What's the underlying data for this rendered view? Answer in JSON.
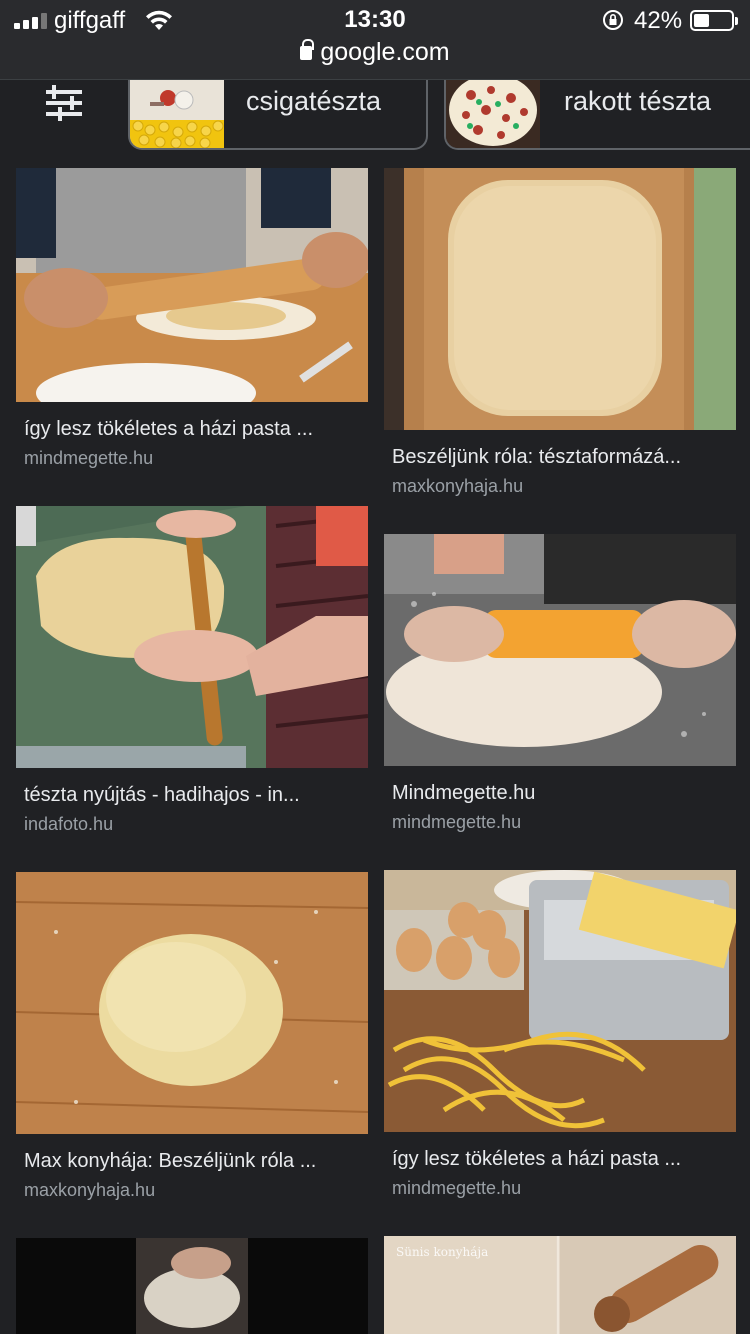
{
  "status_bar": {
    "carrier": "giffgaff",
    "time": "13:30",
    "battery_percent": "42%",
    "battery_level": 0.42
  },
  "address_bar": {
    "url": "google.com"
  },
  "chips": [
    {
      "label": "csigatészta",
      "icon": "pasta-thumb"
    },
    {
      "label": "rakott tészta",
      "icon": "baked-pasta-thumb"
    }
  ],
  "results": [
    {
      "title": "így lesz tökéletes a házi pasta ...",
      "source": "mindmegette.hu"
    },
    {
      "title": "Beszéljünk róla: tésztaformázá...",
      "source": "maxkonyhaja.hu"
    },
    {
      "title": "tészta nyújtás - hadihajos - in...",
      "source": "indafoto.hu"
    },
    {
      "title": "Mindmegette.hu",
      "source": "mindmegette.hu"
    },
    {
      "title": "Max konyhája: Beszéljünk róla ...",
      "source": "maxkonyhaja.hu"
    },
    {
      "title": "így lesz tökéletes a házi pasta ...",
      "source": "mindmegette.hu"
    }
  ],
  "partial_images": [
    {
      "watermark": "Sünis konyhája"
    }
  ]
}
